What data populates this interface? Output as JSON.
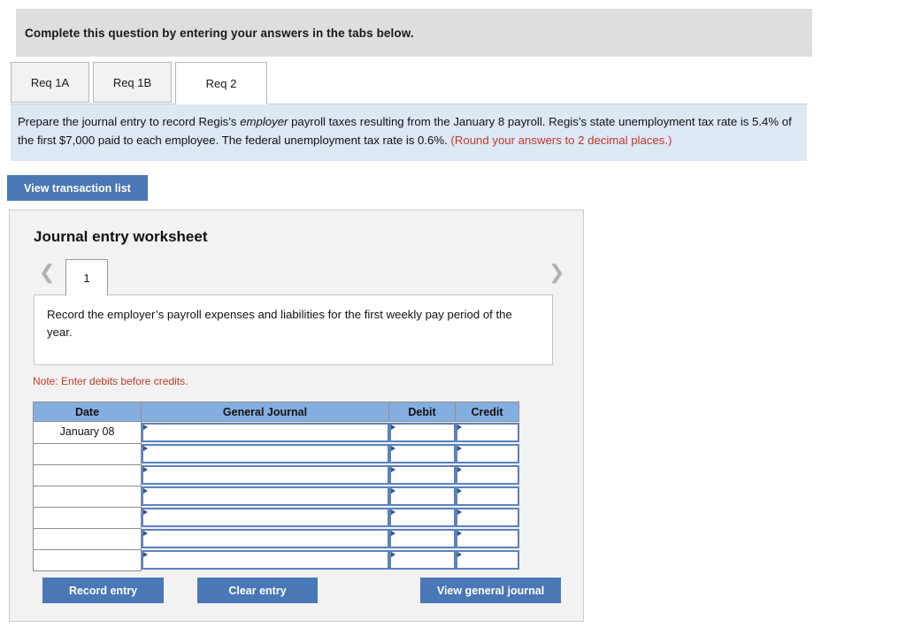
{
  "banner": {
    "text": "Complete this question by entering your answers in the tabs below."
  },
  "tabs": [
    {
      "label": "Req 1A",
      "active": false
    },
    {
      "label": "Req 1B",
      "active": false
    },
    {
      "label": "Req 2",
      "active": true
    }
  ],
  "instruction": {
    "part1": "Prepare the journal entry to record Regis’s ",
    "emphasis": "employer",
    "part2": " payroll taxes resulting from the January 8 payroll. Regis’s state unemployment tax rate is 5.4% of the first $7,000 paid to each employee. The federal unemployment tax rate is 0.6%. ",
    "rounding_note": "(Round your answers to 2 decimal places.)"
  },
  "toolbar": {
    "view_transaction_list_label": "View transaction list"
  },
  "worksheet": {
    "title": "Journal entry worksheet",
    "pager": {
      "prev_icon": "chevron-left-icon",
      "next_icon": "chevron-right-icon",
      "current_page": "1"
    },
    "description": "Record the employer’s payroll expenses and liabilities for the first weekly pay period of the year.",
    "note": "Note: Enter debits before credits.",
    "table": {
      "headers": [
        "Date",
        "General Journal",
        "Debit",
        "Credit"
      ],
      "rows": [
        {
          "date": "January 08",
          "general_journal": "",
          "debit": "",
          "credit": ""
        },
        {
          "date": "",
          "general_journal": "",
          "debit": "",
          "credit": ""
        },
        {
          "date": "",
          "general_journal": "",
          "debit": "",
          "credit": ""
        },
        {
          "date": "",
          "general_journal": "",
          "debit": "",
          "credit": ""
        },
        {
          "date": "",
          "general_journal": "",
          "debit": "",
          "credit": ""
        },
        {
          "date": "",
          "general_journal": "",
          "debit": "",
          "credit": ""
        },
        {
          "date": "",
          "general_journal": "",
          "debit": "",
          "credit": ""
        }
      ]
    },
    "actions": {
      "record_entry_label": "Record entry",
      "clear_entry_label": "Clear entry",
      "view_general_journal_label": "View general journal"
    }
  },
  "colors": {
    "button_blue": "#4a77b5",
    "table_header_blue": "#85aee0",
    "input_border_blue": "#5b82bd",
    "instruction_bg": "#dde8f5",
    "banner_bg": "#dedede",
    "panel_bg": "#f2f2f2",
    "alert_red": "#c0392b"
  }
}
